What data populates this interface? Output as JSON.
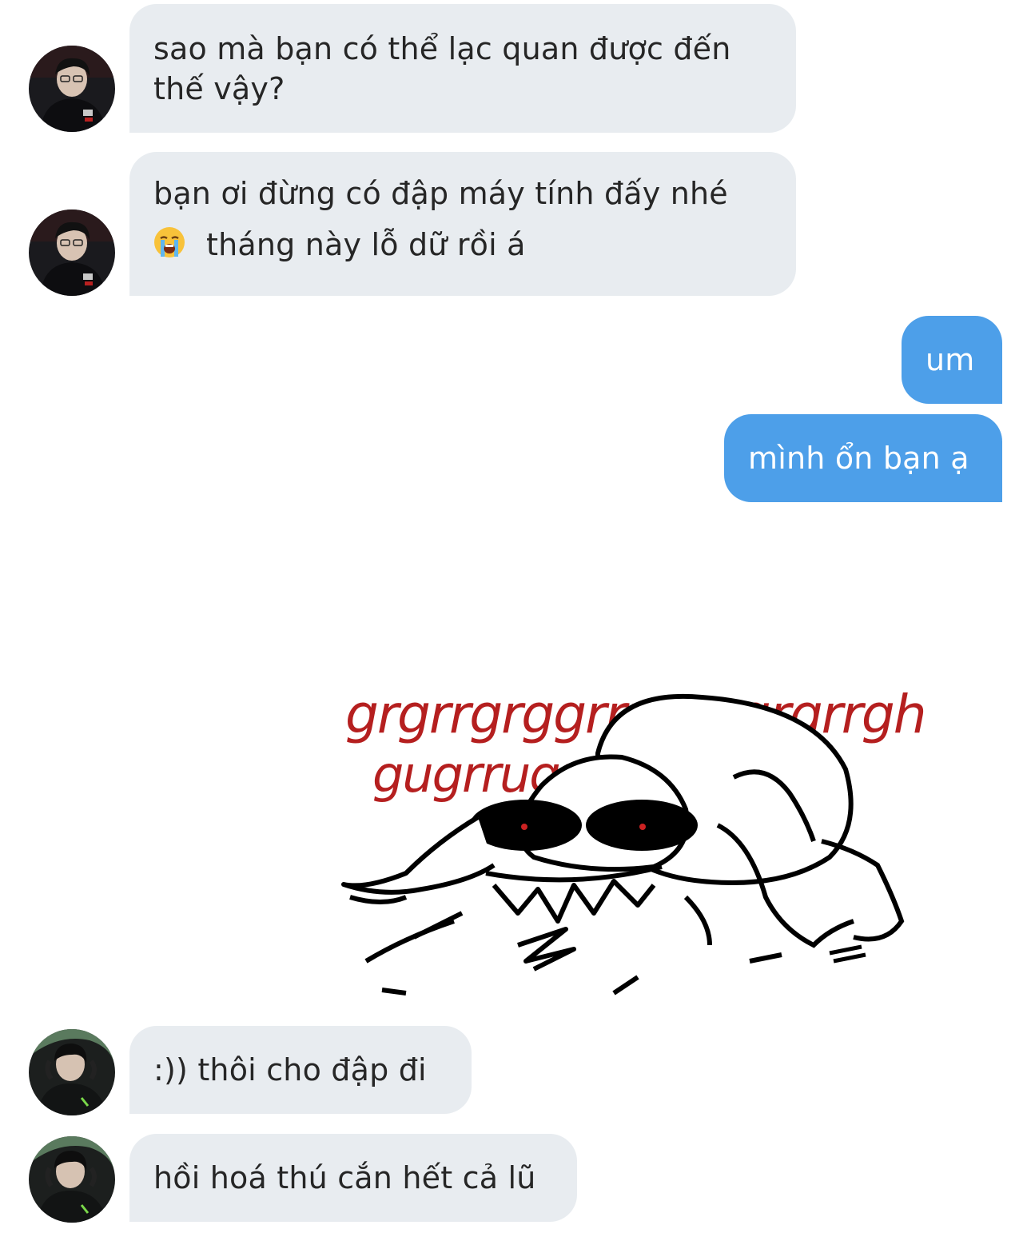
{
  "messages": [
    {
      "type": "received",
      "avatar": "player-avatar-1",
      "lines": [
        "sao mà bạn có thể lạc quan được đến",
        "thế vậy?"
      ]
    },
    {
      "type": "received",
      "avatar": "player-avatar-1",
      "line1": "bạn ơi đừng có đập máy tính đấy nhé",
      "emoji": "loudly-crying-face-icon",
      "line2": "tháng này lỗ dữ rồi á"
    },
    {
      "type": "sent",
      "text": "um"
    },
    {
      "type": "sent",
      "text": "mình ổn bạn ạ"
    },
    {
      "type": "sticker",
      "caption_line1": "grgrrgrggrrrgrrrgrgrrgh",
      "caption_line2": "gugrrugrr grrr"
    },
    {
      "type": "received",
      "avatar": "player-avatar-2",
      "text": ":)) thôi cho đập đi"
    },
    {
      "type": "received",
      "avatar": "player-avatar-2",
      "text": "hồi hoá thú cắn hết cả lũ"
    }
  ],
  "colors": {
    "received_bubble": "#e8ecf0",
    "sent_bubble": "#4d9fe9",
    "text_dark": "#262626",
    "text_light": "#ffffff",
    "sticker_text": "#b51f1f"
  }
}
